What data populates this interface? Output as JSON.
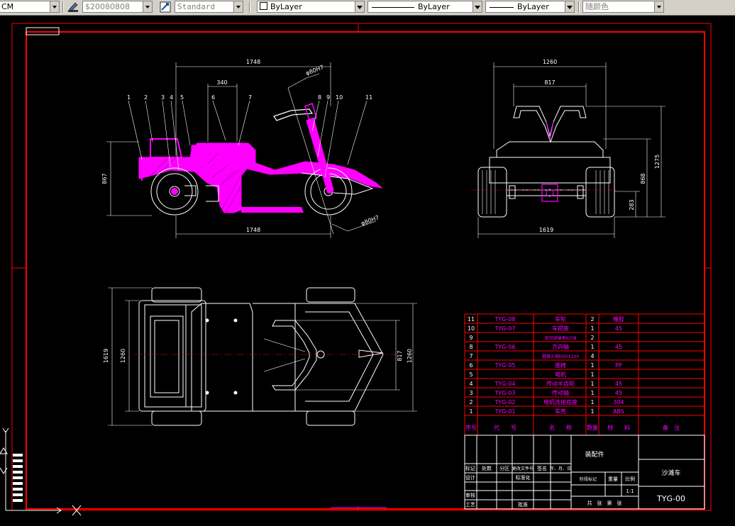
{
  "toolbar": {
    "units_label": "CM",
    "color_value": "$20080808",
    "text_style": "Standard",
    "layer_value": "ByLayer",
    "linetype_value": "ByLayer",
    "lineweight_value": "ByLayer",
    "plot_style": "随颜色"
  },
  "drawing": {
    "side_view": {
      "dim_overall_top": "1748",
      "dim_overall_bottom": "1748",
      "dim_seat": "340",
      "dim_height": "867",
      "dim_diameter_top": "φ80H7",
      "dim_diameter_bottom": "φ80H7",
      "callouts": [
        "1",
        "2",
        "3",
        "4",
        "5",
        "6",
        "7",
        "8",
        "9",
        "10",
        "11"
      ]
    },
    "front_view": {
      "dim_top": "1260",
      "dim_handle": "817",
      "dim_width": "1619",
      "dim_868": "868",
      "dim_1275": "1275",
      "dim_283": "283"
    },
    "top_view": {
      "dim_1619": "1619",
      "dim_1260_left": "1260",
      "dim_817": "817",
      "dim_1260_right": "1260"
    },
    "parts_list": {
      "rows": [
        {
          "no": "11",
          "code": "TYG-08",
          "name": "车轮",
          "qty": "2",
          "material": "橡胶"
        },
        {
          "no": "10",
          "code": "TYG-07",
          "name": "车把座",
          "qty": "1",
          "material": "45"
        },
        {
          "no": "9",
          "code": "",
          "name": "深沟球轴承6208",
          "qty": "2",
          "material": ""
        },
        {
          "no": "8",
          "code": "TYG-06",
          "name": "方向轴",
          "qty": "1",
          "material": "45"
        },
        {
          "no": "7",
          "code": "",
          "name": "圆锥头销M30X200",
          "qty": "4",
          "material": ""
        },
        {
          "no": "6",
          "code": "TYG-05",
          "name": "座椅",
          "qty": "1",
          "material": "PP"
        },
        {
          "no": "5",
          "code": "",
          "name": "电机",
          "qty": "1",
          "material": ""
        },
        {
          "no": "4",
          "code": "TYG-04",
          "name": "传动半齿轮",
          "qty": "1",
          "material": "45"
        },
        {
          "no": "3",
          "code": "TYG-03",
          "name": "传动轴",
          "qty": "1",
          "material": "45"
        },
        {
          "no": "2",
          "code": "TYG-02",
          "name": "电机连接底座",
          "qty": "1",
          "material": "304"
        },
        {
          "no": "1",
          "code": "TYG-01",
          "name": "车壳",
          "qty": "1",
          "material": "ABS"
        }
      ],
      "header": {
        "no": "序号",
        "code": "代　　号",
        "name": "名　　称",
        "qty": "数量",
        "material": "材　　料",
        "note": "备　注"
      }
    },
    "title_block": {
      "assembly": "装配件",
      "product": "沙滩车",
      "drawing_no": "TYG-00",
      "scale": "1:1",
      "labels": {
        "mark": "标记",
        "count": "处数",
        "zone": "分区",
        "change_doc": "更改文件号",
        "sign": "签名",
        "date": "年、月、日",
        "design": "设计",
        "standardize": "标准化",
        "stage_mark": "阶段标记",
        "weight": "重量",
        "ratio": "比例",
        "review": "审核",
        "process": "工艺",
        "approve": "批准",
        "sheets": "共　张　第　张"
      }
    }
  }
}
